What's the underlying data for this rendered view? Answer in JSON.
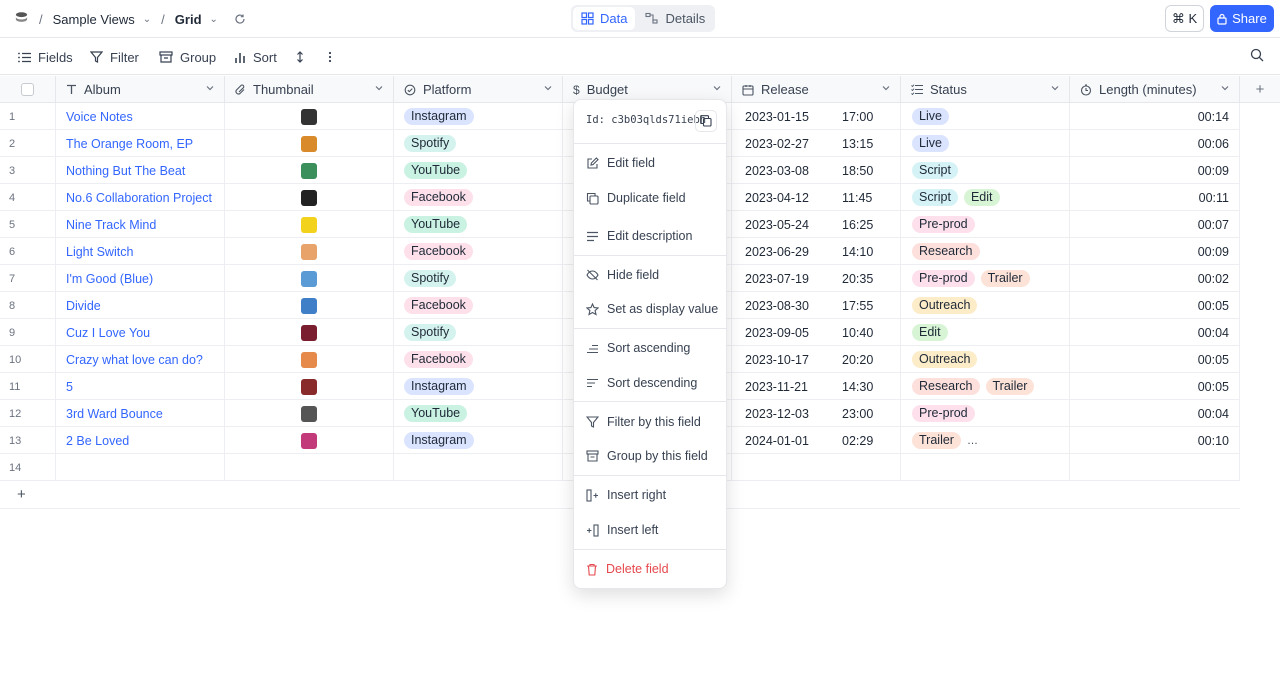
{
  "breadcrumb": {
    "base": "Sample Views",
    "view": "Grid"
  },
  "view_toggle": {
    "data": "Data",
    "details": "Details"
  },
  "cmdk": "⌘ K",
  "share": "Share",
  "toolbar": {
    "fields": "Fields",
    "filter": "Filter",
    "group": "Group",
    "sort": "Sort"
  },
  "columns": [
    "Album",
    "Thumbnail",
    "Platform",
    "Budget",
    "Release",
    "Status",
    "Length (minutes)"
  ],
  "colors": {
    "accent": "#3366ff",
    "danger": "#e5484d",
    "Instagram": "#dbe4ff",
    "Spotify": "#d5f3ee",
    "YouTube": "#c9f2e2",
    "Facebook": "#fde0ea",
    "Live": "#dbe4ff",
    "Script": "#d5f3f6",
    "Edit": "#d7f5d4",
    "Pre-prod": "#fde0ec",
    "Research": "#fde0dc",
    "Trailer": "#fde2d8",
    "Outreach": "#fdecc8"
  },
  "rows": [
    {
      "n": "1",
      "album": "Voice Notes",
      "thumb": "#333333",
      "platform": "Instagram",
      "date": "2023-01-15",
      "time": "17:00",
      "status": [
        "Live"
      ],
      "length": "00:14"
    },
    {
      "n": "2",
      "album": "The Orange Room, EP",
      "thumb": "#d98a2b",
      "platform": "Spotify",
      "date": "2023-02-27",
      "time": "13:15",
      "status": [
        "Live"
      ],
      "length": "00:06"
    },
    {
      "n": "3",
      "album": "Nothing But The Beat",
      "thumb": "#3a8f5a",
      "platform": "YouTube",
      "date": "2023-03-08",
      "time": "18:50",
      "status": [
        "Script"
      ],
      "length": "00:09"
    },
    {
      "n": "4",
      "album": "No.6 Collaboration Project",
      "thumb": "#222222",
      "platform": "Facebook",
      "date": "2023-04-12",
      "time": "11:45",
      "status": [
        "Script",
        "Edit"
      ],
      "length": "00:11"
    },
    {
      "n": "5",
      "album": "Nine Track Mind",
      "thumb": "#f2d21b",
      "platform": "YouTube",
      "date": "2023-05-24",
      "time": "16:25",
      "status": [
        "Pre-prod"
      ],
      "length": "00:07"
    },
    {
      "n": "6",
      "album": "Light Switch",
      "thumb": "#e8a36a",
      "platform": "Facebook",
      "date": "2023-06-29",
      "time": "14:10",
      "status": [
        "Research"
      ],
      "length": "00:09"
    },
    {
      "n": "7",
      "album": "I'm Good (Blue)",
      "thumb": "#5b9bd5",
      "platform": "Spotify",
      "date": "2023-07-19",
      "time": "20:35",
      "status": [
        "Pre-prod",
        "Trailer"
      ],
      "length": "00:02"
    },
    {
      "n": "8",
      "album": "Divide",
      "thumb": "#3f7fc7",
      "platform": "Facebook",
      "date": "2023-08-30",
      "time": "17:55",
      "status": [
        "Outreach"
      ],
      "length": "00:05"
    },
    {
      "n": "9",
      "album": "Cuz I Love You",
      "thumb": "#7a1d2e",
      "platform": "Spotify",
      "date": "2023-09-05",
      "time": "10:40",
      "status": [
        "Edit"
      ],
      "length": "00:04"
    },
    {
      "n": "10",
      "album": "Crazy what love can do?",
      "thumb": "#e58a4a",
      "platform": "Facebook",
      "date": "2023-10-17",
      "time": "20:20",
      "status": [
        "Outreach"
      ],
      "length": "00:05"
    },
    {
      "n": "11",
      "album": "5",
      "thumb": "#8a2b2b",
      "platform": "Instagram",
      "date": "2023-11-21",
      "time": "14:30",
      "status": [
        "Research",
        "Trailer"
      ],
      "length": "00:05"
    },
    {
      "n": "12",
      "album": "3rd Ward Bounce",
      "thumb": "#555555",
      "platform": "YouTube",
      "date": "2023-12-03",
      "time": "23:00",
      "status": [
        "Pre-prod"
      ],
      "length": "00:04"
    },
    {
      "n": "13",
      "album": "2 Be Loved",
      "thumb": "#c23a7a",
      "platform": "Instagram",
      "date": "2024-01-01",
      "time": "02:29",
      "status": [
        "Trailer",
        "…"
      ],
      "length": "00:10"
    },
    {
      "n": "14",
      "album": "",
      "thumb": "",
      "platform": "",
      "date": "",
      "time": "",
      "status": [],
      "length": ""
    }
  ],
  "menu": {
    "id": "Id: c3b03qlds71iebh",
    "edit_field": "Edit field",
    "duplicate_field": "Duplicate field",
    "edit_description": "Edit description",
    "hide_field": "Hide field",
    "set_display": "Set as display value",
    "sort_asc": "Sort ascending",
    "sort_desc": "Sort descending",
    "filter_field": "Filter by this field",
    "group_field": "Group by this field",
    "insert_right": "Insert right",
    "insert_left": "Insert left",
    "delete_field": "Delete field"
  }
}
